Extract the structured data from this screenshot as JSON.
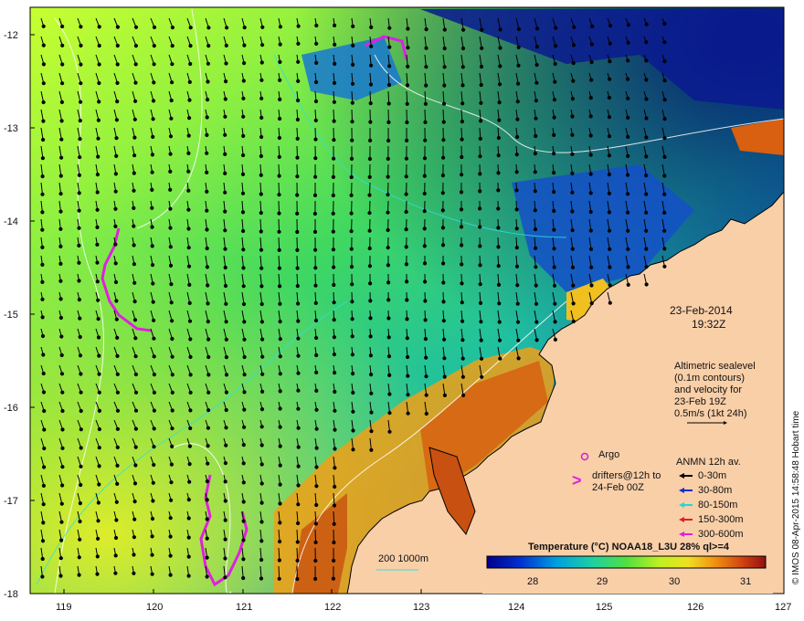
{
  "map": {
    "lat_ticks": [
      "-12",
      "-13",
      "-14",
      "-15",
      "-16",
      "-17",
      "-18"
    ],
    "lon_ticks": [
      "119",
      "120",
      "121",
      "122",
      "123",
      "124",
      "125",
      "126",
      "127"
    ]
  },
  "annotations": {
    "date": "23-Feb-2014",
    "time": "19:32Z",
    "altimetry_lines": [
      "Altimetric sealevel",
      "(0.1m contours)",
      "and velocity for",
      "23-Feb 19Z",
      "0.5m/s (1kt 24h)"
    ],
    "argo_label": "Argo",
    "drifters_lines": [
      "drifters@12h to",
      "24-Feb 00Z"
    ],
    "anmn_title": "ANMN 12h av.",
    "depth_bands": [
      {
        "label": "0-30m",
        "color": "#000000"
      },
      {
        "label": "30-80m",
        "color": "#1030d0"
      },
      {
        "label": "80-150m",
        "color": "#20d8d8"
      },
      {
        "label": "150-300m",
        "color": "#e02020"
      },
      {
        "label": "300-600m",
        "color": "#e020e0"
      }
    ],
    "isobath_label": "200  1000m"
  },
  "colorbar": {
    "title": "Temperature (°C) NOAA18_L3U 28% ql>=4",
    "ticks": [
      "28",
      "29",
      "30",
      "31"
    ]
  },
  "credit": "© IMOS 08-Apr-2015 14:58:48 Hobart time",
  "colors": {
    "land": "#f9cfa8",
    "argo": "#d020d0",
    "drifter": "#e020e0"
  }
}
